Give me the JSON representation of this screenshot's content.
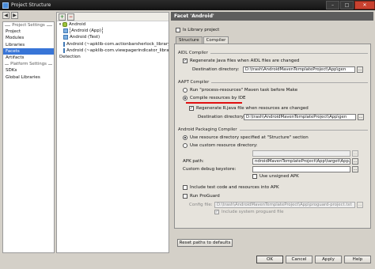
{
  "window": {
    "title": "Project Structure"
  },
  "left_nav": {
    "project_settings_header": "Project Settings",
    "project_settings": [
      "Project",
      "Modules",
      "Libraries",
      "Facets",
      "Artifacts"
    ],
    "platform_settings_header": "Platform Settings",
    "platform_settings": [
      "SDKs",
      "Global Libraries"
    ],
    "selected": "Facets"
  },
  "tree": {
    "root": "Android",
    "children": [
      "Android (App)",
      "Android (Test)",
      "Android (~apklib-com.actionbarsherlock_library_4.1...",
      "Android (~apklib-com.viewpagerindicator_library_2..."
    ],
    "detection": "Detection"
  },
  "facet": {
    "title": "Facet 'Android'",
    "is_library_label": "Is Library project",
    "tabs": [
      "Structure",
      "Compiler"
    ],
    "active_tab": "Compiler",
    "aidl": {
      "title": "AIDL Compiler",
      "regenerate_label": "Regenerate Java files when AIDL files are changed",
      "dest_label": "Destination directory:",
      "dest_value": "D:\\trash\\AndroidMavenTemplateProject\\App\\gen"
    },
    "aapt": {
      "title": "AAPT Compiler",
      "run_task_label": "Run \"process-resources\" Maven task before Make",
      "compile_ide_label": "Compile resources by IDE",
      "regenerate_r_label": "Regenerate R.java file when resources are changed",
      "dest_label": "Destination directory:",
      "dest_value": "D:\\trash\\AndroidMavenTemplateProject\\App\\gen"
    },
    "packaging": {
      "title": "Android Packaging Compiler",
      "use_structure_label": "Use resource directory specified at \"Structure\" section",
      "use_custom_label": "Use custom resource directory:",
      "apk_label": "APK path:",
      "apk_value": "ndroidMavenTemplateProject\\App\\target\\App.apk",
      "custom_keystore_label": "Custom debug keystore:",
      "unsigned_label": "Use unsigned APK",
      "include_test_label": "Include test code and resources into APK",
      "proguard_label": "Run ProGuard",
      "config_file_label": "Config file:",
      "config_file_value": "D:\\trash\\AndroidMavenTemplateProject\\App\\proguard-project.txt",
      "include_system_label": "Include system proguard file"
    },
    "reset_button": "Reset paths to defaults"
  },
  "buttons": {
    "ok": "OK",
    "cancel": "Cancel",
    "apply": "Apply",
    "help": "Help"
  }
}
